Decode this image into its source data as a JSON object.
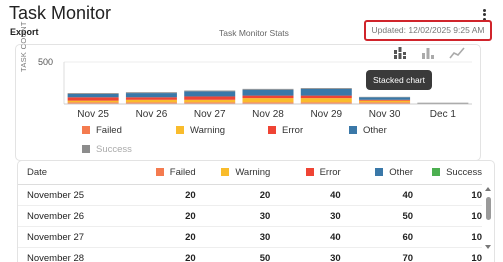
{
  "header": {
    "title": "Task Monitor",
    "export_label": "Export",
    "stats_label": "Task Monitor Stats",
    "updated_text": "Updated: 12/02/2025 9:25 AM"
  },
  "toolbar": {
    "tooltip": "Stacked chart",
    "icons": [
      "stacked-bar-chart-icon",
      "bar-chart-icon",
      "line-chart-icon"
    ]
  },
  "colors": {
    "Failed": "#f47b4f",
    "Warning": "#f9bc2c",
    "Error": "#ef4434",
    "Other": "#3a78a8",
    "Success": "#8c8c8c",
    "accent": "#d0242b"
  },
  "chart_data": {
    "type": "bar",
    "stacked": true,
    "ylabel": "TASK COUNT",
    "ylim": [
      0,
      500
    ],
    "yticks": [
      500
    ],
    "categories": [
      "Nov 25",
      "Nov 26",
      "Nov 27",
      "Nov 28",
      "Nov 29",
      "Nov 30",
      "Dec 1"
    ],
    "series": [
      {
        "name": "Failed",
        "values": [
          20,
          20,
          20,
          20,
          20,
          20,
          0
        ]
      },
      {
        "name": "Warning",
        "values": [
          20,
          30,
          30,
          50,
          50,
          20,
          0
        ]
      },
      {
        "name": "Error",
        "values": [
          40,
          30,
          40,
          30,
          30,
          10,
          0
        ]
      },
      {
        "name": "Other",
        "values": [
          40,
          50,
          60,
          70,
          80,
          30,
          0
        ]
      },
      {
        "name": "Success",
        "values": [
          10,
          10,
          10,
          10,
          10,
          5,
          15
        ]
      }
    ],
    "legend": [
      "Failed",
      "Warning",
      "Error",
      "Other",
      "Success"
    ],
    "legend_position": "bottom"
  },
  "table": {
    "columns": [
      "Date",
      "Failed",
      "Warning",
      "Error",
      "Other",
      "Success"
    ],
    "rows": [
      [
        "November 25",
        "20",
        "20",
        "40",
        "40",
        "10"
      ],
      [
        "November 26",
        "20",
        "30",
        "30",
        "50",
        "10"
      ],
      [
        "November 27",
        "20",
        "30",
        "40",
        "60",
        "10"
      ],
      [
        "November 28",
        "20",
        "50",
        "30",
        "70",
        "10"
      ]
    ]
  }
}
